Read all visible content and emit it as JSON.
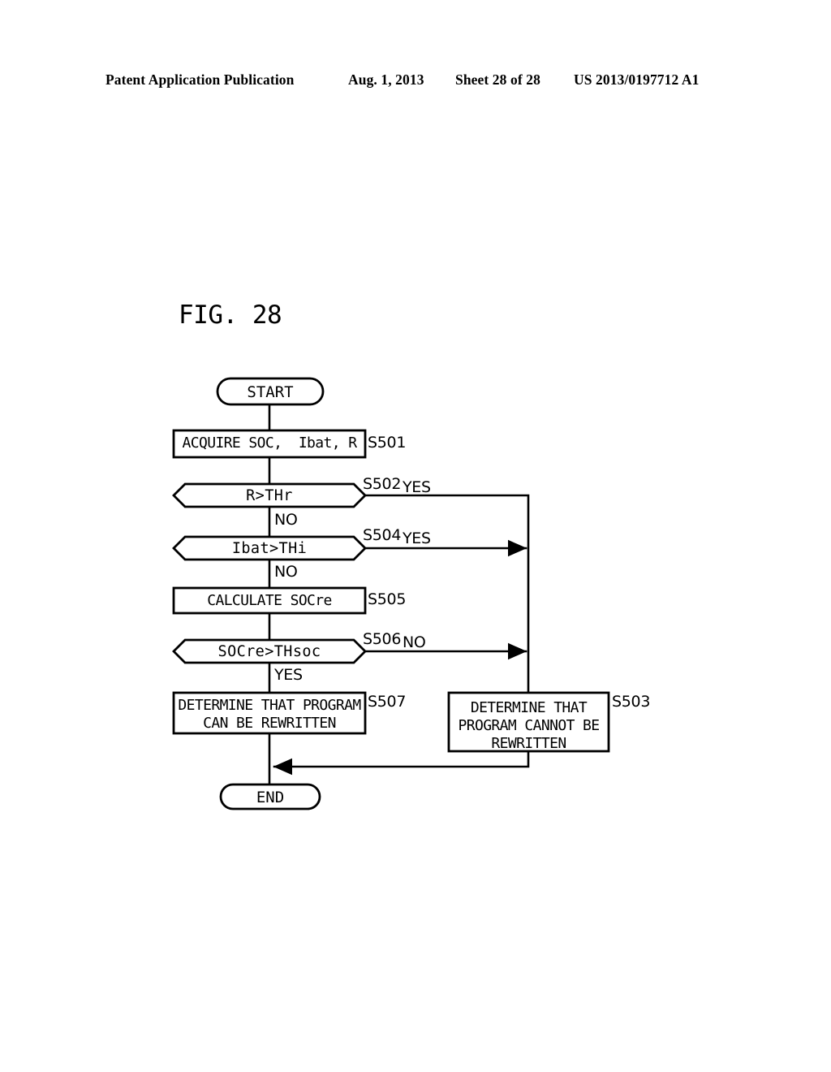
{
  "header": {
    "publication": "Patent Application Publication",
    "date": "Aug. 1, 2013",
    "sheet": "Sheet 28 of 28",
    "patent_number": "US 2013/0197712 A1"
  },
  "figure": {
    "label": "FIG. 28"
  },
  "flowchart": {
    "nodes": {
      "start": {
        "text": "START",
        "shape": "terminal"
      },
      "s501": {
        "text": "ACQUIRE SOC,  Ibat, R",
        "shape": "process",
        "ref": "S501"
      },
      "s502": {
        "text": "R>THr",
        "shape": "decision",
        "ref": "S502"
      },
      "s504": {
        "text": "Ibat>THi",
        "shape": "decision",
        "ref": "S504"
      },
      "s505": {
        "text": "CALCULATE SOCre",
        "shape": "process",
        "ref": "S505"
      },
      "s506": {
        "text": "SOCre>THsoc",
        "shape": "decision",
        "ref": "S506"
      },
      "s507": {
        "text": "DETERMINE THAT PROGRAM\nCAN BE REWRITTEN",
        "shape": "process",
        "ref": "S507"
      },
      "s503": {
        "text": "DETERMINE THAT\nPROGRAM CANNOT BE\nREWRITTEN",
        "shape": "process",
        "ref": "S503"
      },
      "end": {
        "text": "END",
        "shape": "terminal"
      }
    },
    "branches": {
      "s502_yes": "YES",
      "s502_no": "NO",
      "s504_yes": "YES",
      "s504_no": "NO",
      "s506_no": "NO",
      "s506_yes": "YES"
    },
    "colors": {
      "stroke": "#000000",
      "fill": "#ffffff",
      "text": "#000000"
    }
  }
}
